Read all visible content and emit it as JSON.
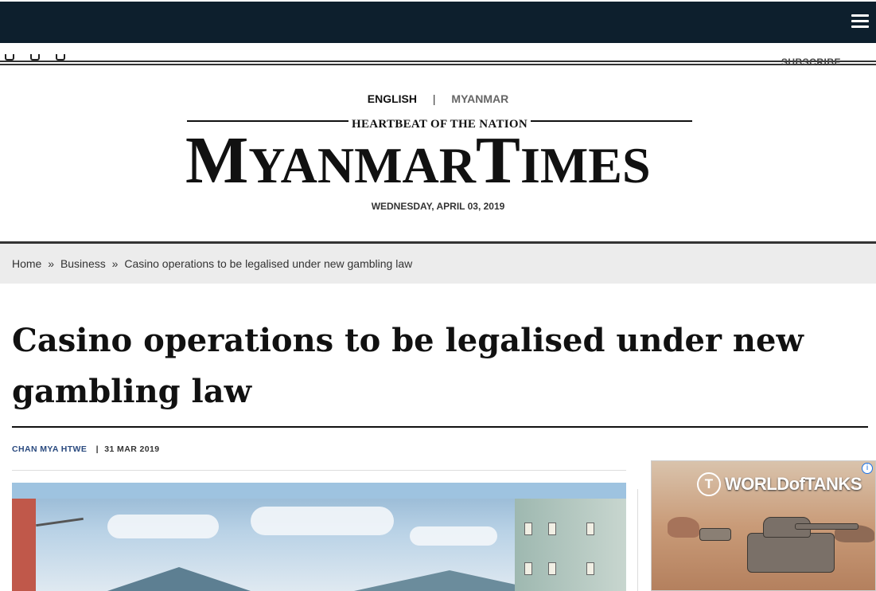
{
  "header": {
    "menu_icon": "hamburger-menu-icon",
    "social_icons": [
      "facebook-icon",
      "twitter-icon",
      "instagram-icon"
    ],
    "subscribe_label": "SUBSCRIBE"
  },
  "language": {
    "english": "ENGLISH",
    "separator": "|",
    "myanmar": "MYANMAR"
  },
  "masthead": {
    "tagline": "HEARTBEAT OF THE NATION",
    "logo_m": "M",
    "logo_yanmar": "YANMAR",
    "logo_t": "T",
    "logo_imes": "IMES",
    "date": "WEDNESDAY, APRIL 03, 2019"
  },
  "breadcrumb": {
    "home": "Home",
    "sep": "»",
    "section": "Business",
    "current": "Casino operations to be legalised under new gambling law"
  },
  "article": {
    "headline": "Casino operations to be legalised under new gambling law",
    "author": "CHAN MYA HTWE",
    "byline_sep": "|",
    "date": "31 MAR 2019"
  },
  "ad": {
    "brand": "WORLDofTANKS",
    "brand_icon": "T",
    "info_icon": "i"
  },
  "colors": {
    "topbar": "#0d1f2d",
    "author_link": "#2a4a7f",
    "breadcrumb_bg": "#ececec"
  }
}
